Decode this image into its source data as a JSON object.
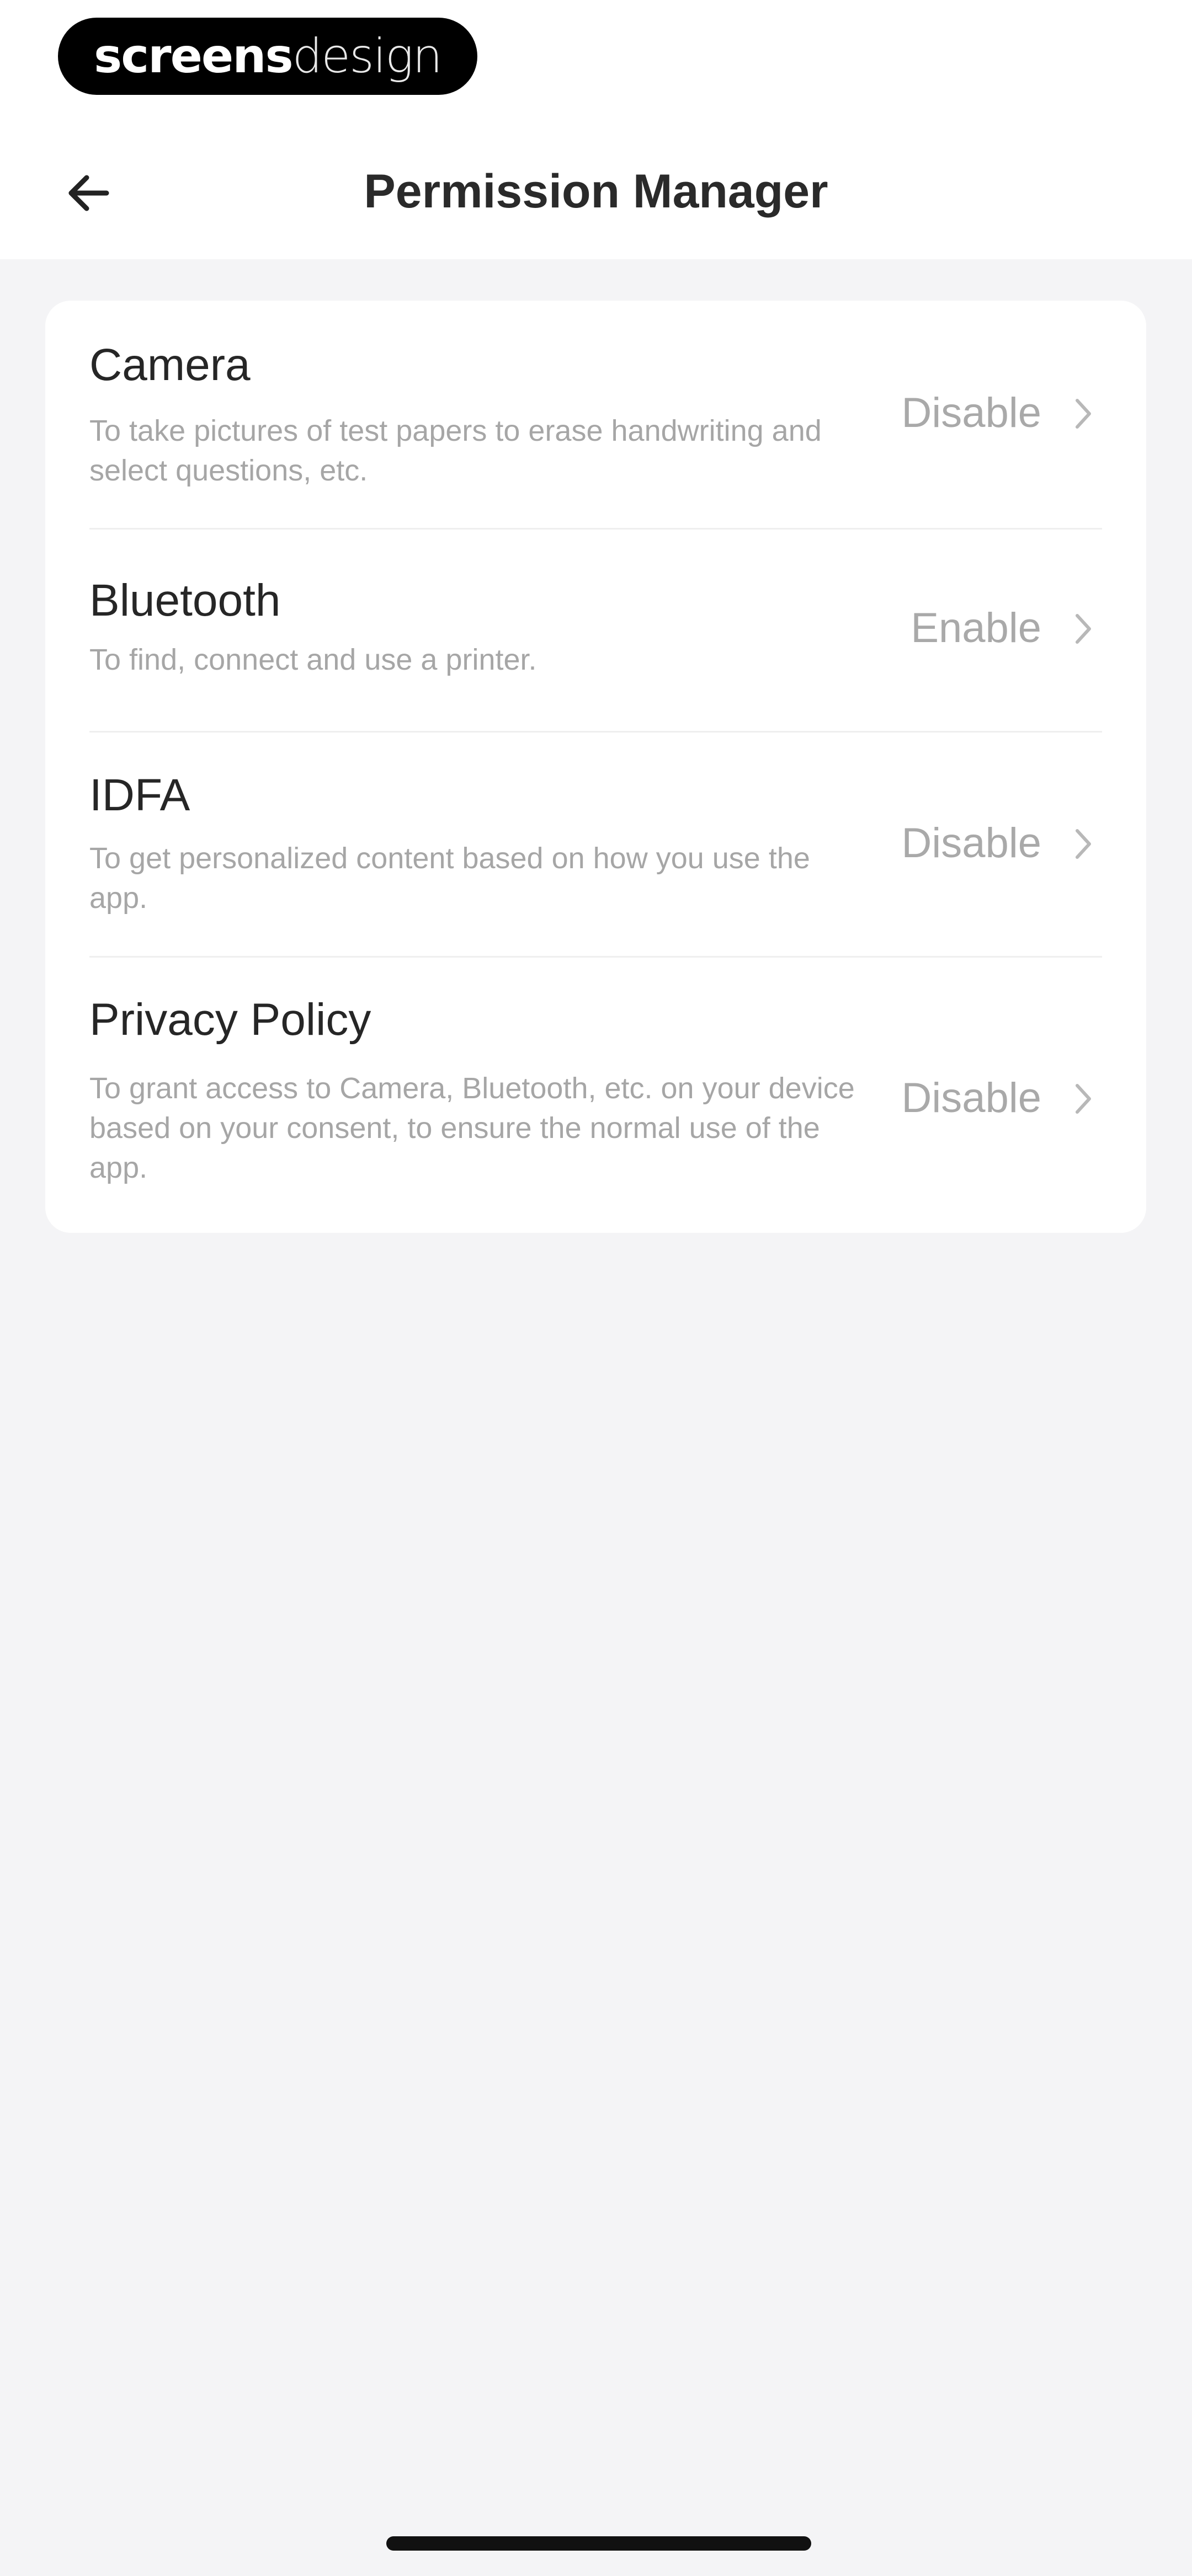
{
  "brand": {
    "part1": "screens",
    "part2": "design"
  },
  "header": {
    "title": "Permission Manager",
    "back_icon": "arrow-left-icon"
  },
  "permissions": [
    {
      "title": "Camera",
      "description": "To take pictures of test papers to erase handwriting and select questions, etc.",
      "status": "Disable"
    },
    {
      "title": "Bluetooth",
      "description": "To find, connect and use a printer.",
      "status": "Enable"
    },
    {
      "title": "IDFA",
      "description": "To get personalized content based on how you use the app.",
      "status": "Disable"
    },
    {
      "title": "Privacy Policy",
      "description": "To grant access to Camera, Bluetooth, etc. on your device based on your consent, to ensure the normal use of the app.",
      "status": "Disable"
    }
  ],
  "colors": {
    "background": "#f4f4f6",
    "card": "#ffffff",
    "title_text": "#262626",
    "secondary_text": "#a6a6a6"
  }
}
